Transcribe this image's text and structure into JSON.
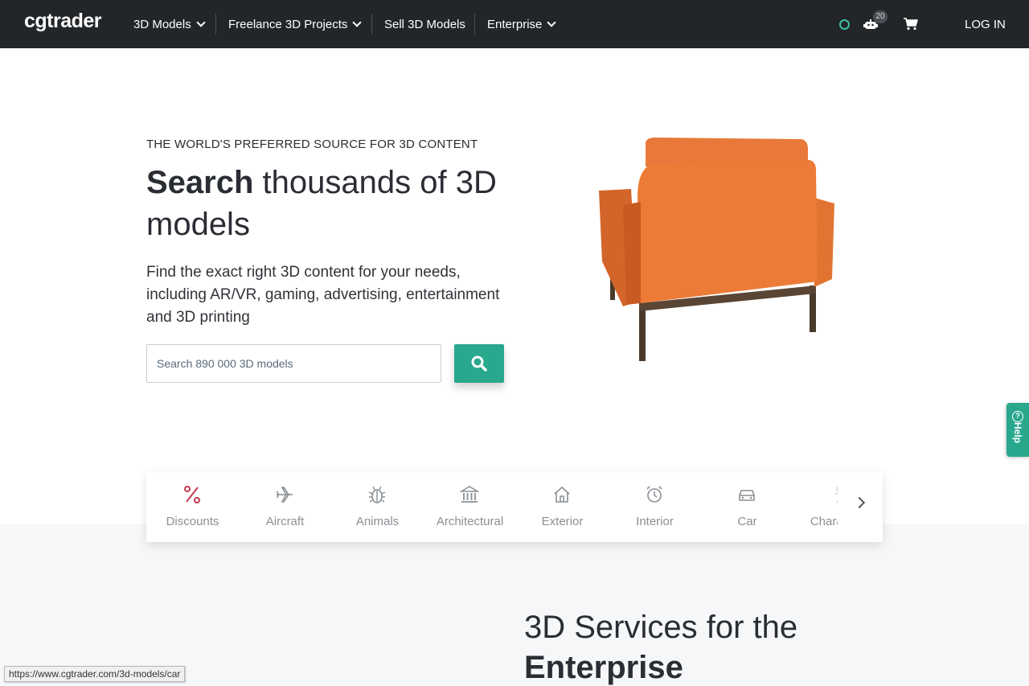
{
  "brand": {
    "logo_text": "cgtrader",
    "accent_color": "#2aa88e",
    "nav_bg": "#232629"
  },
  "nav": {
    "items": [
      {
        "label": "3D Models",
        "has_dropdown": true
      },
      {
        "label": "Freelance 3D Projects",
        "has_dropdown": true
      },
      {
        "label": "Sell 3D Models",
        "has_dropdown": false
      },
      {
        "label": "Enterprise",
        "has_dropdown": true
      }
    ],
    "notification_count": "20",
    "login_label": "LOG IN",
    "icons": [
      "search-icon",
      "robot-icon",
      "cart-icon"
    ]
  },
  "hero": {
    "eyebrow": "THE WORLD'S PREFERRED SOURCE FOR 3D CONTENT",
    "title_bold": "Search",
    "title_rest": " thousands of 3D models",
    "description": "Find the exact right 3D content for your needs, including AR/VR, gaming, advertising, entertainment and 3D printing",
    "search_placeholder": "Search 890 000 3D models",
    "search_button_icon": "search-icon"
  },
  "help": {
    "label": "Help"
  },
  "categories": [
    {
      "label": "Discounts",
      "icon": "percent-icon",
      "highlight": "#c8374f"
    },
    {
      "label": "Aircraft",
      "icon": "airplane-icon"
    },
    {
      "label": "Animals",
      "icon": "bug-icon"
    },
    {
      "label": "Architectural",
      "icon": "building-columns-icon"
    },
    {
      "label": "Exterior",
      "icon": "house-icon"
    },
    {
      "label": "Interior",
      "icon": "clock-icon"
    },
    {
      "label": "Car",
      "icon": "car-icon"
    },
    {
      "label": "Characters",
      "icon": "character-icon"
    }
  ],
  "enterprise": {
    "title_line1": "3D Services for the",
    "title_bold": "Enterprise"
  },
  "status_bar": {
    "url": "https://www.cgtrader.com/3d-models/car"
  }
}
